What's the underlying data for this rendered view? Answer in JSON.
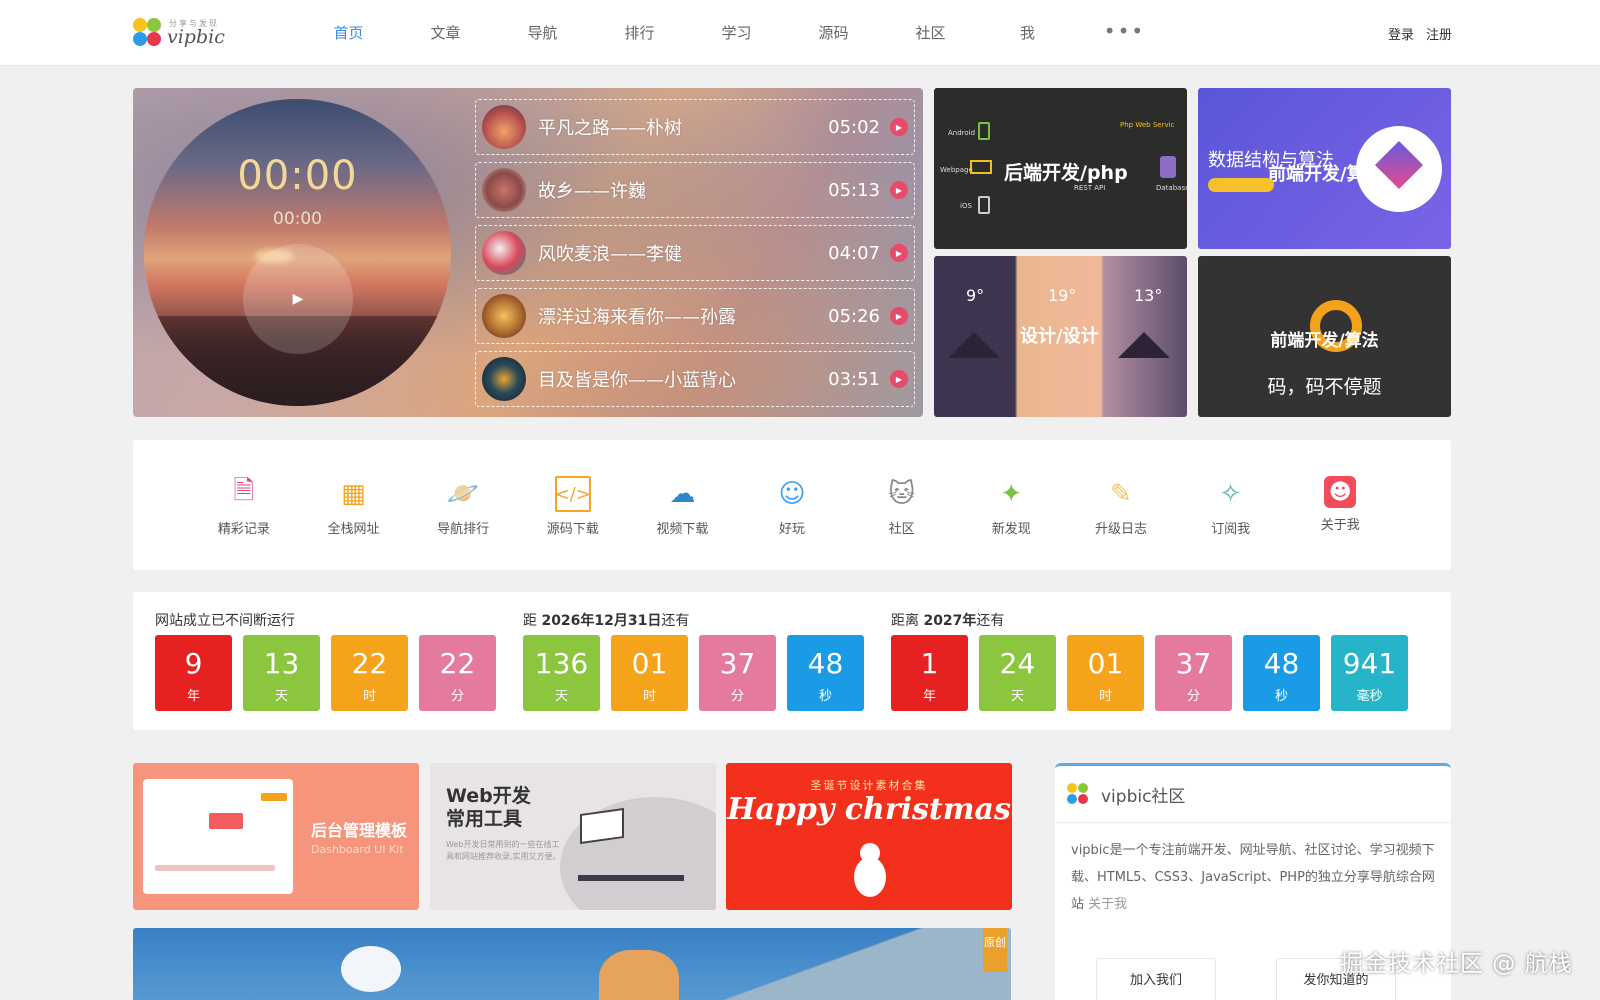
{
  "header": {
    "logo_word": "vipbic",
    "logo_tag": "分享与发现",
    "nav": [
      "首页",
      "文章",
      "导航",
      "排行",
      "学习",
      "源码",
      "社区",
      "我"
    ],
    "more": "•••",
    "login": "登录",
    "register": "注册"
  },
  "player": {
    "time_big": "00:00",
    "time_small": "00:00",
    "play_icon": "▶",
    "tracks": [
      {
        "title": "平凡之路——朴树",
        "duration": "05:02"
      },
      {
        "title": "故乡——许巍",
        "duration": "05:13"
      },
      {
        "title": "风吹麦浪——李健",
        "duration": "04:07"
      },
      {
        "title": "漂洋过海来看你——孙露",
        "duration": "05:26"
      },
      {
        "title": "目及皆是你——小蓝背心",
        "duration": "03:51"
      }
    ]
  },
  "tiles": {
    "t1": {
      "label": "后端开发/php",
      "php": "Php Web Servic",
      "android": "Android",
      "webpage": "Webpage",
      "ios": "iOS",
      "rest": "REST API",
      "database": "Database"
    },
    "t2": {
      "label": "数据结构与算法",
      "label2": "前端开发/算"
    },
    "t3": {
      "label": "设计/设计",
      "d1": "9°",
      "d2": "19°",
      "d3": "13°"
    },
    "t4": {
      "label": "前端开发/算法",
      "label2": "码，码不停题"
    }
  },
  "shortcuts": [
    {
      "label": "精彩记录",
      "icon": "document-icon",
      "glyph": "🗎",
      "color": "#e8457a"
    },
    {
      "label": "全栈网址",
      "icon": "grid-icon",
      "glyph": "▦",
      "color": "#f5a623"
    },
    {
      "label": "导航排行",
      "icon": "planet-icon",
      "glyph": "🪐",
      "color": "#4caf50"
    },
    {
      "label": "源码下载",
      "icon": "code-icon",
      "glyph": "</>",
      "color": "#f5a623"
    },
    {
      "label": "视频下载",
      "icon": "cloud-download-icon",
      "glyph": "☁",
      "color": "#2f87c8"
    },
    {
      "label": "好玩",
      "icon": "smile-bubble-icon",
      "glyph": "☺",
      "color": "#3fa2f0"
    },
    {
      "label": "社区",
      "icon": "cat-icon",
      "glyph": "🐱",
      "color": "#888888"
    },
    {
      "label": "新发现",
      "icon": "sparkle-icon",
      "glyph": "✦",
      "color": "#7cc243"
    },
    {
      "label": "升级日志",
      "icon": "pencil-icon",
      "glyph": "✎",
      "color": "#f2c55c"
    },
    {
      "label": "订阅我",
      "icon": "star-wand-icon",
      "glyph": "✧",
      "color": "#4db6ac"
    },
    {
      "label": "关于我",
      "icon": "smiley-icon",
      "glyph": "☻",
      "color": "#f24c5a"
    }
  ],
  "countdown": {
    "g1": {
      "label_bold": "网站成立",
      "label_rest": "已不间断运行",
      "boxes": [
        {
          "n": "9",
          "u": "年",
          "color": "#e52121"
        },
        {
          "n": "13",
          "u": "天",
          "color": "#8cc63f"
        },
        {
          "n": "22",
          "u": "时",
          "color": "#f5a31a"
        },
        {
          "n": "22",
          "u": "分",
          "color": "#e57aa0"
        }
      ]
    },
    "g2": {
      "label_pre": "距 ",
      "label_bold": "2026年12月31日",
      "label_rest": "还有",
      "boxes": [
        {
          "n": "136",
          "u": "天",
          "color": "#8cc63f"
        },
        {
          "n": "01",
          "u": "时",
          "color": "#f5a31a"
        },
        {
          "n": "37",
          "u": "分",
          "color": "#e57aa0"
        },
        {
          "n": "48",
          "u": "秒",
          "color": "#1a9be6"
        }
      ]
    },
    "g3": {
      "label_pre": "距离 ",
      "label_bold": "2027年",
      "label_rest": "还有",
      "boxes": [
        {
          "n": "1",
          "u": "年",
          "color": "#e52121"
        },
        {
          "n": "24",
          "u": "天",
          "color": "#8cc63f"
        },
        {
          "n": "01",
          "u": "时",
          "color": "#f5a31a"
        },
        {
          "n": "37",
          "u": "分",
          "color": "#e57aa0"
        },
        {
          "n": "48",
          "u": "秒",
          "color": "#1a9be6"
        },
        {
          "n": "941",
          "u": "毫秒",
          "color": "#26b5c8"
        }
      ]
    }
  },
  "banners": {
    "b1": {
      "title": "后台管理模板",
      "sub": "Dashboard UI Kit"
    },
    "b2": {
      "title": "Web开发\n常用工具",
      "sub": "Web开发日常用到的一些在线工具和网站推荐收录,实用又方便。"
    },
    "b3": {
      "top": "圣诞节设计素材合集",
      "happy": "Happy christmas"
    }
  },
  "wide": {
    "orig": "原创"
  },
  "community": {
    "name": "vipbic社区",
    "desc": "vipbic是一个专注前端开发、网址导航、社区讨论、学习视频下载、HTML5、CSS3、JavaScript、PHP的独立分享导航综合网站",
    "about": "关于我",
    "join": "加入我们",
    "share": "发你知道的"
  },
  "watermark": "掘金技术社区 @ 航栈"
}
